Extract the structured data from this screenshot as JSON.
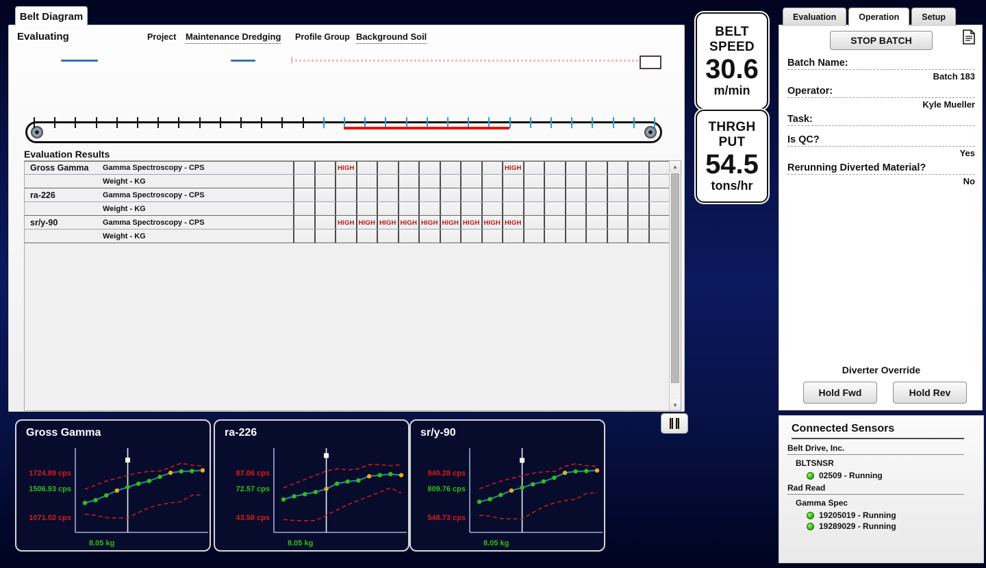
{
  "window": {
    "tab_label": "Belt Diagram"
  },
  "header": {
    "status": "Evaluating",
    "project_label": "Project",
    "project_value": "Maintenance Dredging",
    "profile_group_label": "Profile Group",
    "profile_group_value": "Background Soil"
  },
  "belt": {
    "total_ticks": 31,
    "blue_tick_start_index": 14,
    "red_segment_start_index": 15,
    "red_segment_end_index": 23
  },
  "evaluation_results": {
    "title": "Evaluation Results",
    "alert_label": "HIGH",
    "columns": 19,
    "rows": [
      {
        "nuclide": "Gross Gamma",
        "measurement": "Gamma Spectroscopy - CPS",
        "alerts": [
          2,
          10
        ]
      },
      {
        "nuclide": "",
        "measurement": "Weight - KG",
        "alerts": []
      },
      {
        "nuclide": "ra-226",
        "measurement": "Gamma Spectroscopy - CPS",
        "alerts": []
      },
      {
        "nuclide": "",
        "measurement": "Weight - KG",
        "alerts": []
      },
      {
        "nuclide": "sr/y-90",
        "measurement": "Gamma Spectroscopy - CPS",
        "alerts": [
          2,
          3,
          4,
          5,
          6,
          7,
          8,
          9,
          10
        ]
      },
      {
        "nuclide": "",
        "measurement": "Weight - KG",
        "alerts": []
      }
    ]
  },
  "controls": {
    "pause_label": "Pause"
  },
  "gauges": [
    {
      "name": "belt-speed",
      "label_line1": "BELT",
      "label_line2": "SPEED",
      "value": "30.6",
      "unit": "m/min"
    },
    {
      "name": "throughput",
      "label_line1": "THRGH",
      "label_line2": "PUT",
      "value": "54.5",
      "unit": "tons/hr"
    }
  ],
  "right_tabs": [
    {
      "label": "Evaluation",
      "active": false
    },
    {
      "label": "Operation",
      "active": true
    },
    {
      "label": "Setup",
      "active": false
    }
  ],
  "operation": {
    "stop_batch_label": "STOP BATCH",
    "report_icon": "document-icon",
    "fields": [
      {
        "key": "Batch Name:",
        "value": "Batch 183"
      },
      {
        "key": "Operator:",
        "value": "Kyle Mueller"
      },
      {
        "key": "Task:",
        "value": ""
      },
      {
        "key": "Is QC?",
        "value": "Yes"
      },
      {
        "key": "Rerunning Diverted Material?",
        "value": "No"
      }
    ],
    "diverter_override_label": "Diverter Override",
    "hold_fwd_label": "Hold Fwd",
    "hold_rev_label": "Hold Rev"
  },
  "sensors": {
    "title": "Connected Sensors",
    "groups": [
      {
        "vendor": "Belt Drive, Inc.",
        "model": "BLTSNSR",
        "items": [
          {
            "label": "02509 - Running",
            "status": "Running"
          }
        ]
      },
      {
        "vendor": "Rad Read",
        "model": "Gamma Spec",
        "items": [
          {
            "label": "19205019 - Running",
            "status": "Running"
          },
          {
            "label": "19289029 - Running",
            "status": "Running"
          }
        ]
      }
    ]
  },
  "colors": {
    "alert": "#b81414",
    "belt_red": "#f01010",
    "belt_blue": "#19a3e8",
    "chart_line": "#1e8f96",
    "chart_green": "#2fbf14",
    "chart_orange": "#f0a81e",
    "chart_limit_red": "#d91a1a",
    "panel_bg": "#080c2c"
  },
  "chart_data": [
    {
      "type": "line",
      "name": "gross-gamma",
      "title": "Gross Gamma",
      "xlabel": "8.05 kg",
      "ylabel": "",
      "x_tick_label": "8.05 kg",
      "y_tick_labels": [
        {
          "text": "1724.89 cps",
          "color": "#d91a1a",
          "value": 1724.89
        },
        {
          "text": "1506.93 cps",
          "color": "#2fbf14",
          "value": 1506.93
        },
        {
          "text": "1071.02 cps",
          "color": "#d91a1a",
          "value": 1071.02
        }
      ],
      "ylim": [
        900,
        1900
      ],
      "series": [
        {
          "name": "measured",
          "values": [
            1280,
            1320,
            1390,
            1460,
            1510,
            1560,
            1600,
            1660,
            1720,
            1740,
            1745,
            1755
          ],
          "point_colors": [
            "green",
            "green",
            "green",
            "orange",
            "green",
            "green",
            "green",
            "green",
            "orange",
            "green",
            "green",
            "orange"
          ]
        },
        {
          "name": "upper limit",
          "values": [
            1480,
            1540,
            1600,
            1640,
            1680,
            1720,
            1740,
            1745,
            1800,
            1860,
            1830,
            1820
          ]
        },
        {
          "name": "lower limit",
          "values": [
            1115,
            1100,
            1065,
            1060,
            1062,
            1140,
            1210,
            1255,
            1280,
            1300,
            1390,
            1400
          ]
        }
      ],
      "cursor_x_index": 4,
      "cursor_value": 1506.93
    },
    {
      "type": "line",
      "name": "ra-226",
      "title": "ra-226",
      "xlabel": "8.05 kg",
      "x_tick_label": "8.05 kg",
      "y_tick_labels": [
        {
          "text": "87.06 cps",
          "color": "#d91a1a",
          "value": 87.06
        },
        {
          "text": "72.57 cps",
          "color": "#2fbf14",
          "value": 72.57
        },
        {
          "text": "43.58 cps",
          "color": "#d91a1a",
          "value": 43.58
        }
      ],
      "ylim": [
        35,
        100
      ],
      "series": [
        {
          "name": "measured",
          "values": [
            63,
            66,
            68,
            70,
            73,
            78,
            80,
            81,
            85,
            86,
            87,
            86
          ],
          "point_colors": [
            "green",
            "green",
            "green",
            "green",
            "orange",
            "green",
            "green",
            "green",
            "orange",
            "green",
            "green",
            "orange"
          ]
        },
        {
          "name": "upper limit",
          "values": [
            74,
            78,
            82,
            86,
            90,
            92,
            91,
            92,
            96,
            96,
            95,
            96
          ]
        },
        {
          "name": "lower limit",
          "values": [
            44,
            43,
            43,
            43,
            48,
            53,
            58,
            62,
            66,
            70,
            74,
            69
          ]
        }
      ],
      "cursor_x_index": 4,
      "cursor_value": 72.57
    },
    {
      "type": "line",
      "name": "sr-y-90",
      "title": "sr/y-90",
      "xlabel": "8.05 kg",
      "x_tick_label": "8.05 kg",
      "y_tick_labels": [
        {
          "text": "940.28 cps",
          "color": "#d91a1a",
          "value": 940.28
        },
        {
          "text": "809.76 cps",
          "color": "#2fbf14",
          "value": 809.76
        },
        {
          "text": "548.73 cps",
          "color": "#d91a1a",
          "value": 548.73
        }
      ],
      "ylim": [
        460,
        1040
      ],
      "series": [
        {
          "name": "measured",
          "values": [
            690,
            712,
            748,
            785,
            810,
            838,
            862,
            893,
            935,
            947,
            950,
            955
          ],
          "point_colors": [
            "green",
            "green",
            "green",
            "orange",
            "green",
            "green",
            "green",
            "green",
            "orange",
            "green",
            "green",
            "orange"
          ]
        },
        {
          "name": "upper limit",
          "values": [
            800,
            832,
            865,
            888,
            910,
            932,
            944,
            947,
            990,
            1012,
            996,
            990
          ]
        },
        {
          "name": "lower limit",
          "values": [
            576,
            568,
            548,
            545,
            546,
            598,
            648,
            680,
            700,
            712,
            760,
            768
          ]
        }
      ],
      "cursor_x_index": 4,
      "cursor_value": 809.76
    }
  ]
}
